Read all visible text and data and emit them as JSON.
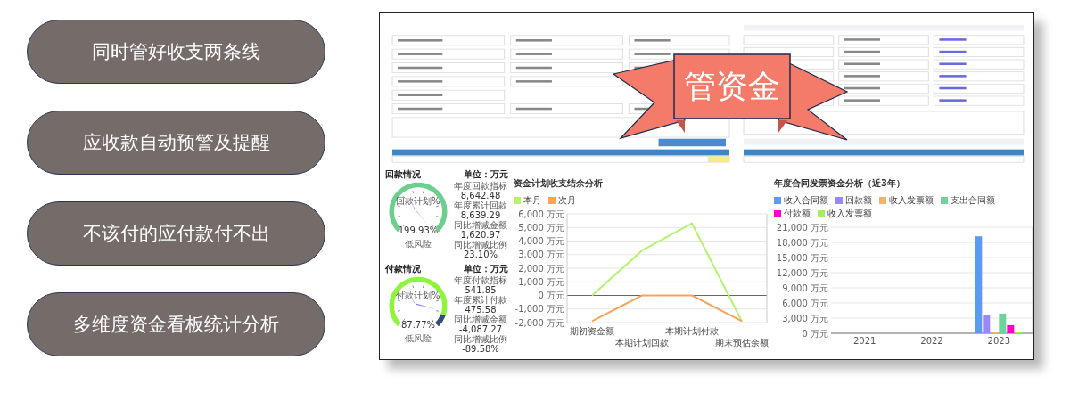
{
  "features": [
    "同时管好收支两条线",
    "应收款自动预警及提醒",
    "不该付的应付款付不出",
    "多维度资金看板统计分析"
  ],
  "banner": {
    "text": "管资金"
  },
  "gauges": [
    {
      "title": "回款情况",
      "unit": "单位：万元",
      "dial_label": "回款计划%",
      "value": "199.93%",
      "risk": "低风险",
      "kind": "receipt",
      "stats": [
        {
          "label": "年度回款指标",
          "value": "8,642.48"
        },
        {
          "label": "年度累计回款",
          "value": "8,639.29"
        },
        {
          "label": "同比增减金额",
          "value": "1,620.97"
        },
        {
          "label": "同比增减比例",
          "value": "23.10%"
        }
      ]
    },
    {
      "title": "付款情况",
      "unit": "单位：万元",
      "dial_label": "付款计划%",
      "value": "87.77%",
      "risk": "低风险",
      "kind": "payment",
      "stats": [
        {
          "label": "年度付款指标",
          "value": "541.85"
        },
        {
          "label": "年度累计付款",
          "value": "475.58"
        },
        {
          "label": "同比增减金额",
          "value": "-4,087.27"
        },
        {
          "label": "同比增减比例",
          "value": "-89.58%"
        }
      ]
    }
  ],
  "line_panel": {
    "chart_data": {
      "type": "line",
      "title": "资金计划收支结余分析",
      "legend": true,
      "grid": true,
      "categories": [
        "期初资金额",
        "本期计划回款",
        "本期计划付款",
        "期末预估余额"
      ],
      "series": [
        {
          "name": "本月",
          "color": "#b5f36e",
          "values": [
            0,
            3300,
            5300,
            -1900
          ]
        },
        {
          "name": "次月",
          "color": "#f7a35c",
          "values": [
            -1900,
            0,
            0,
            -1900
          ]
        }
      ],
      "ylim": [
        -2000,
        6000
      ],
      "yticks": [
        {
          "value": 6000,
          "label": "6,000 万元"
        },
        {
          "value": 5000,
          "label": "5,000 万元"
        },
        {
          "value": 4000,
          "label": "4,000 万元"
        },
        {
          "value": 3000,
          "label": "3,000 万元"
        },
        {
          "value": 2000,
          "label": "2,000 万元"
        },
        {
          "value": 1000,
          "label": "1,000 万元"
        },
        {
          "value": 0,
          "label": "0 万元"
        },
        {
          "value": -1000,
          "label": "-1,000 万元"
        },
        {
          "value": -2000,
          "label": "-2,000 万元"
        }
      ]
    }
  },
  "bar_panel": {
    "chart_data": {
      "type": "bar",
      "title": "年度合同发票资金分析（近3年）",
      "legend": true,
      "grid": true,
      "categories": [
        "2021",
        "2022",
        "2023"
      ],
      "series": [
        {
          "name": "收入合同额",
          "color": "#5b9cf0",
          "values": [
            0,
            0,
            19200
          ]
        },
        {
          "name": "回款额",
          "color": "#9b87f5",
          "values": [
            0,
            0,
            3600
          ]
        },
        {
          "name": "收入发票额",
          "color": "#f5b26b",
          "values": [
            0,
            0,
            300
          ]
        },
        {
          "name": "支出合同额",
          "color": "#6fd39a",
          "values": [
            0,
            0,
            3900
          ]
        },
        {
          "name": "付款额",
          "color": "#ff00cc",
          "values": [
            0,
            0,
            1600
          ]
        },
        {
          "name": "收入发票额",
          "color": "#a3f05a",
          "values": [
            0,
            0,
            200
          ]
        }
      ],
      "ylim": [
        0,
        21000
      ],
      "yticks": [
        {
          "value": 21000,
          "label": "21,000 万元"
        },
        {
          "value": 18000,
          "label": "18,000 万元"
        },
        {
          "value": 15000,
          "label": "15,000 万元"
        },
        {
          "value": 12000,
          "label": "12,000 万元"
        },
        {
          "value": 9000,
          "label": "9,000 万元"
        },
        {
          "value": 6000,
          "label": "6,000 万元"
        },
        {
          "value": 3000,
          "label": "3,000 万元"
        },
        {
          "value": 0,
          "label": "0 万元"
        }
      ]
    }
  }
}
